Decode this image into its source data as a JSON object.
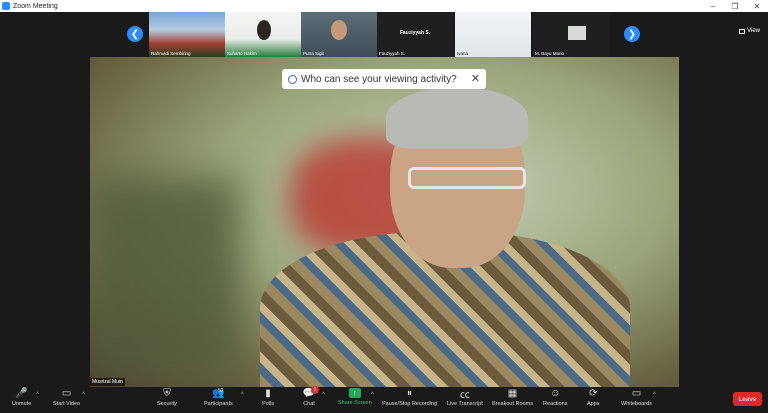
{
  "window": {
    "title": "Zoom Meeting",
    "controls": [
      "–",
      "❐",
      "✕"
    ]
  },
  "strip": {
    "thumbnails": [
      {
        "label": "Rahmadi Sembiring",
        "center_name": ""
      },
      {
        "label": "Suharto Hakim",
        "center_name": ""
      },
      {
        "label": "Putra Sigit",
        "center_name": ""
      },
      {
        "label": "Fauziyyah S.",
        "center_name": "Fauziyyah S."
      },
      {
        "label": "Ivana",
        "center_name": ""
      },
      {
        "label": "M. Bayu Mario",
        "center_name": ""
      }
    ],
    "view_label": "View"
  },
  "viewing_notice": "Who can see your viewing activity?",
  "active_speaker": "Musrizal Muin",
  "toolbar": {
    "unmute": "Unmute",
    "start_video": "Start Video",
    "security": "Security",
    "participants": "Participants",
    "participants_count": "52",
    "polls": "Polls",
    "chat": "Chat",
    "chat_badge": "1",
    "share_screen": "Share Screen",
    "recording": "Pause/Stop Recording",
    "live_transcript": "Live Transcript",
    "breakout": "Breakout Rooms",
    "reactions": "Reactions",
    "apps": "Apps",
    "whiteboards": "Whiteboards",
    "leave": "Leave"
  }
}
